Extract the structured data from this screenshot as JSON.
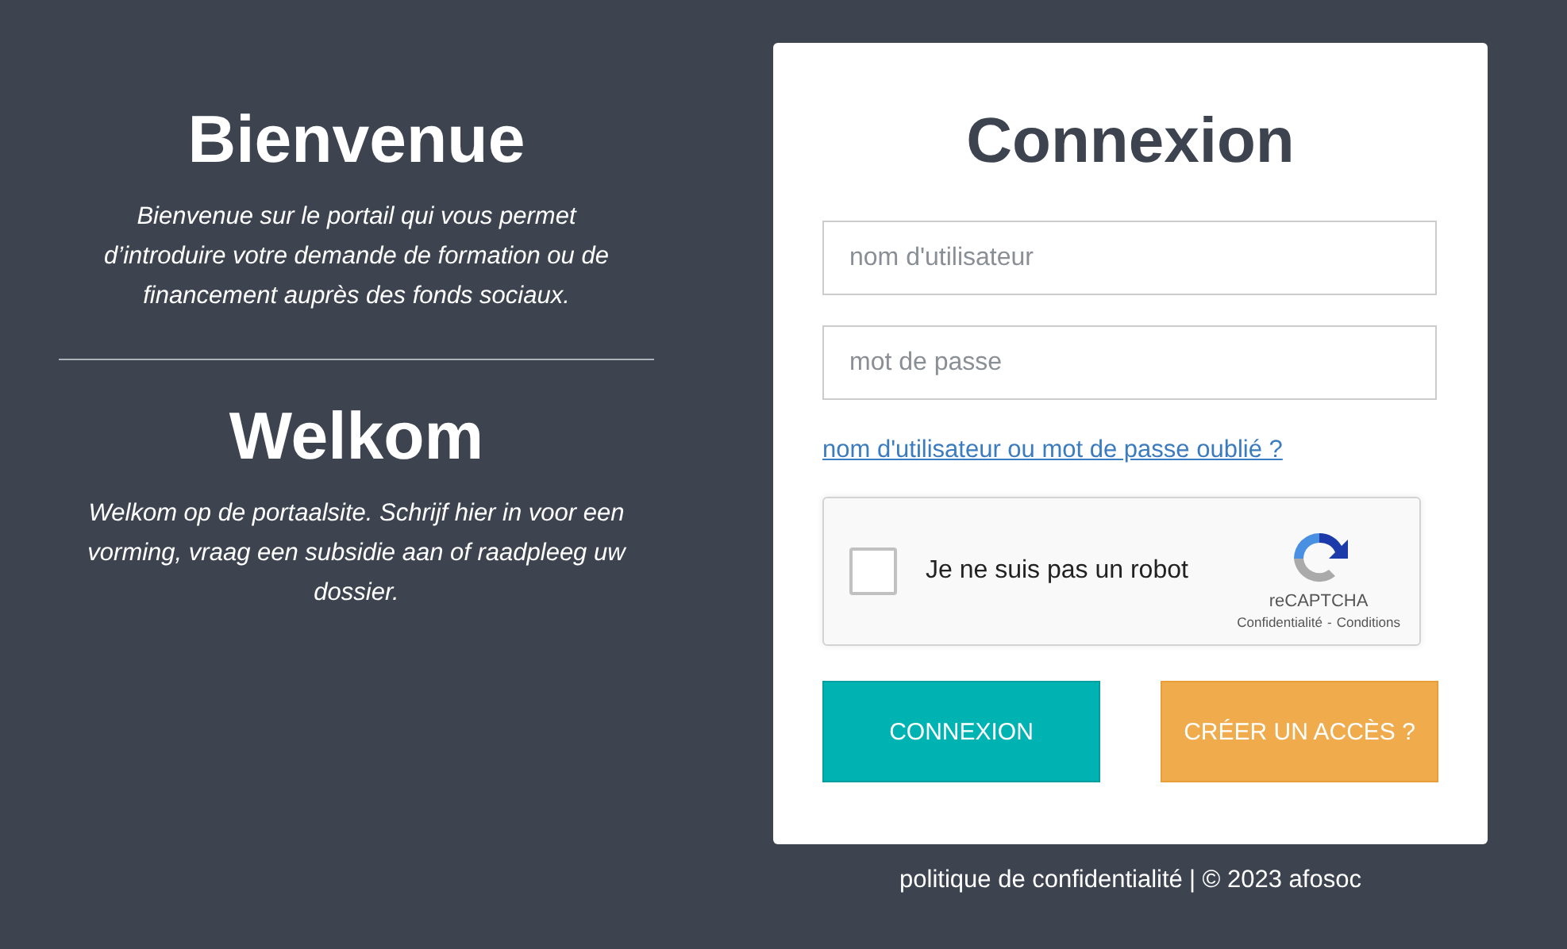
{
  "intro": [
    {
      "title": "Bienvenue",
      "text": "Bienvenue sur le portail qui vous permet d’introduire votre demande de formation ou de financement auprès des fonds sociaux."
    },
    {
      "title": "Welkom",
      "text": "Welkom op de portaalsite. Schrijf hier in voor een vorming, vraag een subsidie aan of raadpleeg uw dossier."
    }
  ],
  "login": {
    "title": "Connexion",
    "fields": [
      {
        "placeholder": "nom d'utilisateur"
      },
      {
        "placeholder": "mot de passe"
      }
    ],
    "forgot_link": "nom d'utilisateur ou mot de passe oublié ?",
    "captcha": {
      "label": "Je ne suis pas un robot",
      "checked": false,
      "brand": "reCAPTCHA",
      "privacy": "Confidentialité",
      "separator": "-",
      "terms": "Conditions"
    },
    "buttons": [
      {
        "label": "CONNEXION",
        "kind": "primary"
      },
      {
        "label": "CRÉER UN ACCÈS ?",
        "kind": "secondary"
      }
    ]
  },
  "footer": {
    "link": "politique de confidentialité",
    "text": "| © 2023 afosoc"
  }
}
